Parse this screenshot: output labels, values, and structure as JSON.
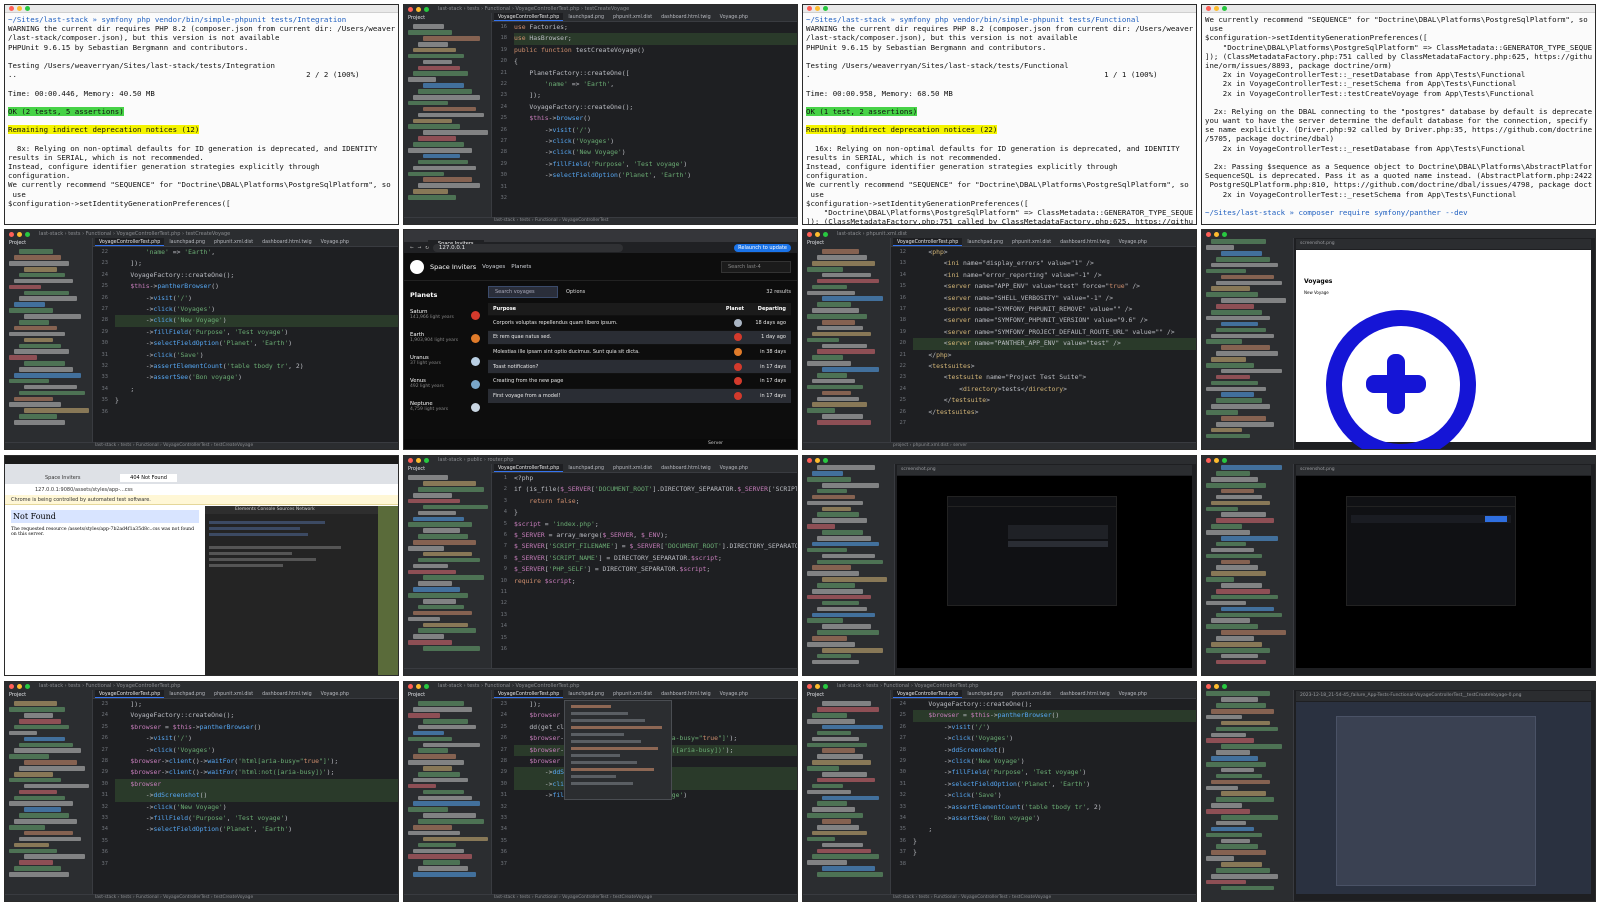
{
  "term1": {
    "lines": [
      "~/Sites/last-stack » symfony php vendor/bin/simple-phpunit tests/Integration",
      "WARNING the current dir requires PHP 8.2 (composer.json from current dir: /Users/weaverryan/Sites",
      "/last-stack/composer.json), but this version is not available",
      "PHPUnit 9.6.15 by Sebastian Bergmann and contributors.",
      "",
      "Testing /Users/weaverryan/Sites/last-stack/tests/Integration",
      "..                                                                 2 / 2 (100%)",
      "",
      "Time: 00:00.446, Memory: 40.50 MB",
      "",
      "OK (2 tests, 5 assertions)",
      "",
      "Remaining indirect deprecation notices (12)",
      "",
      "  8x: Relying on non-optimal defaults for ID generation is deprecated, and IDENTITY",
      "results in SERIAL, which is not recommended.",
      "Instead, configure identifier generation strategies explicitly through",
      "configuration.",
      "We currently recommend \"SEQUENCE\" for \"Doctrine\\DBAL\\Platforms\\PostgreSqlPlatform\", so you should",
      " use",
      "$configuration->setIdentityGenerationPreferences(["
    ]
  },
  "term2": {
    "lines": [
      "~/Sites/last-stack » symfony php vendor/bin/simple-phpunit tests/Functional",
      "WARNING the current dir requires PHP 8.2 (composer.json from current dir: /Users/weaverryan/Sites",
      "/last-stack/composer.json), but this version is not available",
      "PHPUnit 9.6.15 by Sebastian Bergmann and contributors.",
      "",
      "Testing /Users/weaverryan/Sites/last-stack/tests/Functional",
      ".                                                                  1 / 1 (100%)",
      "",
      "Time: 00:00.958, Memory: 68.50 MB",
      "",
      "OK (1 test, 2 assertions)",
      "",
      "Remaining indirect deprecation notices (22)",
      "",
      "  16x: Relying on non-optimal defaults for ID generation is deprecated, and IDENTITY",
      "results in SERIAL, which is not recommended.",
      "Instead, configure identifier generation strategies explicitly through",
      "configuration.",
      "We currently recommend \"SEQUENCE\" for \"Doctrine\\DBAL\\Platforms\\PostgreSqlPlatform\", so you should",
      " use",
      "$configuration->setIdentityGenerationPreferences([",
      "    \"Doctrine\\DBAL\\Platforms\\PostgreSqlPlatform\" => ClassMetadata::GENERATOR_TYPE_SEQUENCE,",
      "]); (ClassMetadataFactory.php:751 called by ClassMetadataFactory.php:625, https://github.com/doct"
    ]
  },
  "term3": {
    "lines": [
      "We currently recommend \"SEQUENCE\" for \"Doctrine\\DBAL\\Platforms\\PostgreSqlPlatform\", so you should",
      " use",
      "$configuration->setIdentityGenerationPreferences([",
      "    \"Doctrine\\DBAL\\Platforms\\PostgreSqlPlatform\" => ClassMetadata::GENERATOR_TYPE_SEQUENCE,",
      "]); (ClassMetadataFactory.php:751 called by ClassMetadataFactory.php:625, https://github.com/doctr",
      "ine/orm/issues/8893, package doctrine/orm)",
      "    2x in VoyageControllerTest::_resetDatabase from App\\Tests\\Functional",
      "    2x in VoyageControllerTest::_resetSchema from App\\Tests\\Functional",
      "    2x in VoyageControllerTest::testCreateVoyage from App\\Tests\\Functional",
      "",
      "  2x: Relying on the DBAL connecting to the \"postgres\" database by default is deprecated. Unless",
      "you want to have the server determine the default database for the connection, specify the databa",
      "se name explicitly. (Driver.php:92 called by Driver.php:35, https://github.com/doctrine/dbal/pull",
      "/5705, package doctrine/dbal)",
      "    2x in VoyageControllerTest::_resetDatabase from App\\Tests\\Functional",
      "",
      "  2x: Passing $sequence as a Sequence object to Doctrine\\DBAL\\Platforms\\AbstractPlatform::getDrop",
      "SequenceSQL is deprecated. Pass it as a quoted name instead. (AbstractPlatform.php:2422 called by",
      " PostgreSQLPlatform.php:810, https://github.com/doctrine/dbal/issues/4798, package doctrine/dbal)",
      "    2x in VoyageControllerTest::_resetSchema from App\\Tests\\Functional",
      "",
      "~/Sites/last-stack » composer require symfony/panther --dev"
    ]
  },
  "ide_common": {
    "project_label": "Project",
    "tabs": [
      "VoyageControllerTest.php",
      "launchpad.png",
      "phpunit.xml.dist",
      "dashboard.html.twig",
      "Voyage.php"
    ]
  },
  "ide1": {
    "crumb": "last-stack › tests › Functional › VoyageControllerTest.php › testCreateVoyage",
    "lines": [
      [
        "16",
        "use Factories;"
      ],
      [
        "18",
        "use HasBrowser;"
      ],
      [
        "19",
        ""
      ],
      [
        "20",
        "public function testCreateVoyage()"
      ],
      [
        "21",
        "{"
      ],
      [
        "22",
        "    PlanetFactory::createOne(["
      ],
      [
        "23",
        "        'name' => 'Earth',"
      ],
      [
        "24",
        "    ]);"
      ],
      [
        "25",
        "    VoyageFactory::createOne();"
      ],
      [
        "26",
        ""
      ],
      [
        "27",
        "    $this->browser()"
      ],
      [
        "28",
        "        ->visit('/')"
      ],
      [
        "29",
        "        ->click('Voyages')"
      ],
      [
        "30",
        "        ->click('New Voyage')"
      ],
      [
        "31",
        "        ->fillField('Purpose', 'Test voyage')"
      ],
      [
        "32",
        "        ->selectFieldOption('Planet', 'Earth')"
      ]
    ],
    "status": "last-stack › tests › Functional › VoyageControllerTest"
  },
  "ide2": {
    "crumb": "last-stack › tests › Functional › VoyageControllerTest.php › testCreateVoyage",
    "lines": [
      [
        "22",
        "        'name' => 'Earth',"
      ],
      [
        "23",
        "    ]);"
      ],
      [
        "24",
        "    VoyageFactory::createOne();"
      ],
      [
        "25",
        ""
      ],
      [
        "26",
        "    $this->pantherBrowser()"
      ],
      [
        "27",
        "        ->visit('/')"
      ],
      [
        "28",
        "        ->click('Voyages')"
      ],
      [
        "29",
        "        ->click('New Voyage')"
      ],
      [
        "30",
        "        ->fillField('Purpose', 'Test voyage')"
      ],
      [
        "31",
        "        ->selectFieldOption('Planet', 'Earth')"
      ],
      [
        "32",
        "        ->click('Save')"
      ],
      [
        "33",
        "        ->assertElementCount('table tbody tr', 2)"
      ],
      [
        "34",
        "        ->assertSee('Bon voyage')"
      ],
      [
        "35",
        "    ;"
      ],
      [
        "36",
        "}"
      ]
    ],
    "status": "last-stack › tests › Functional › VoyageControllerTest › testCreateVoyage"
  },
  "ide3": {
    "crumb": "last-stack › phpunit.xml.dist",
    "lines": [
      [
        "12",
        "    <php>"
      ],
      [
        "13",
        "        <ini name=\"display_errors\" value=\"1\" />"
      ],
      [
        "14",
        "        <ini name=\"error_reporting\" value=\"-1\" />"
      ],
      [
        "15",
        "        <server name=\"APP_ENV\" value=\"test\" force=\"true\" />"
      ],
      [
        "16",
        "        <server name=\"SHELL_VERBOSITY\" value=\"-1\" />"
      ],
      [
        "17",
        "        <server name=\"SYMFONY_PHPUNIT_REMOVE\" value=\"\" />"
      ],
      [
        "18",
        "        <server name=\"SYMFONY_PHPUNIT_VERSION\" value=\"9.6\" />"
      ],
      [
        "19",
        "        <server name=\"SYMFONY_PROJECT_DEFAULT_ROUTE_URL\" value=\"\" />"
      ],
      [
        "20",
        "        <server name=\"PANTHER_APP_ENV\" value=\"test\" />"
      ],
      [
        "21",
        "    </php>"
      ],
      [
        "22",
        ""
      ],
      [
        "23",
        "    <testsuites>"
      ],
      [
        "24",
        "        <testsuite name=\"Project Test Suite\">"
      ],
      [
        "25",
        "            <directory>tests</directory>"
      ],
      [
        "26",
        "        </testsuite>"
      ],
      [
        "27",
        "    </testsuites>"
      ]
    ],
    "status": "project › phpunit.xml.dist › server"
  },
  "ide4": {
    "crumb": "last-stack › public › router.php",
    "lines": [
      [
        "1",
        "<?php"
      ],
      [
        "2",
        "if (is_file($_SERVER['DOCUMENT_ROOT'].DIRECTORY_SEPARATOR.$_SERVER['SCRIPT_NAME"
      ],
      [
        "3",
        "    return false;"
      ],
      [
        "4",
        "}"
      ],
      [
        "5",
        ""
      ],
      [
        "6",
        "$script = 'index.php';"
      ],
      [
        "7",
        ""
      ],
      [
        "8",
        "$_SERVER = array_merge($_SERVER, $_ENV);"
      ],
      [
        "9",
        "$_SERVER['SCRIPT_FILENAME'] = $_SERVER['DOCUMENT_ROOT'].DIRECTORY_SEPARATOR.$sc"
      ],
      [
        "10",
        ""
      ],
      [
        "11",
        "$_SERVER['SCRIPT_NAME'] = DIRECTORY_SEPARATOR.$script;"
      ],
      [
        "12",
        "$_SERVER['PHP_SELF'] = DIRECTORY_SEPARATOR.$script;"
      ],
      [
        "13",
        ""
      ],
      [
        "14",
        "require $script;"
      ],
      [
        "15",
        ""
      ],
      [
        "16",
        ""
      ]
    ],
    "status": ""
  },
  "ide5": {
    "crumb": "last-stack › tests › Functional › VoyageControllerTest.php",
    "lines": [
      [
        "23",
        "    ]);"
      ],
      [
        "24",
        "    VoyageFactory::createOne();"
      ],
      [
        "25",
        ""
      ],
      [
        "26",
        "    $browser = $this->pantherBrowser()"
      ],
      [
        "27",
        "        ->visit('/')"
      ],
      [
        "28",
        "        ->click('Voyages')"
      ],
      [
        "29",
        ""
      ],
      [
        "30",
        "    $browser->client()->waitFor('html[aria-busy=\"true\"]');"
      ],
      [
        "31",
        "    $browser->client()->waitFor('html:not([aria-busy])');"
      ],
      [
        "32",
        ""
      ],
      [
        "33",
        "    $browser"
      ],
      [
        "34",
        "        ->ddScreenshot()"
      ],
      [
        "35",
        "        ->click('New Voyage')"
      ],
      [
        "36",
        "        ->fillField('Purpose', 'Test voyage')"
      ],
      [
        "37",
        "        ->selectFieldOption('Planet', 'Earth')"
      ]
    ],
    "status": "last-stack › tests › Functional › VoyageControllerTest › testCreateVoyage"
  },
  "ide6": {
    "crumb": "last-stack › tests › Functional › VoyageControllerTest.php",
    "lines": [
      [
        "23",
        "    ]);"
      ],
      [
        "24",
        ""
      ],
      [
        "25",
        "    $browser"
      ],
      [
        "26",
        ""
      ],
      [
        "27",
        ""
      ],
      [
        "28",
        ""
      ],
      [
        "29",
        "    dd(get_class($browser));"
      ],
      [
        "30",
        ""
      ],
      [
        "31",
        "    $browser->client()->waitFor('html[aria-busy=\"true\"]');"
      ],
      [
        "32",
        "    $browser->client()->waitFor('html:not([aria-busy])');"
      ],
      [
        "33",
        ""
      ],
      [
        "34",
        "    $browser"
      ],
      [
        "35",
        "        ->ddScreenshot()"
      ],
      [
        "36",
        "        ->click('New Voyage')"
      ],
      [
        "37",
        "        ->fillField('Purpose', 'Test voyage')"
      ]
    ],
    "status": "last-stack › tests › Functional › VoyageControllerTest › testCreateVoyage"
  },
  "ide7": {
    "crumb": "last-stack › tests › Functional › VoyageControllerTest.php",
    "lines": [
      [
        "24",
        "    VoyageFactory::createOne();"
      ],
      [
        "25",
        ""
      ],
      [
        "26",
        "    $browser = $this->pantherBrowser()"
      ],
      [
        "27",
        "        ->visit('/')"
      ],
      [
        "28",
        "        ->click('Voyages')"
      ],
      [
        "29",
        "        ->ddScreenshot()"
      ],
      [
        "30",
        "        ->click('New Voyage')"
      ],
      [
        "31",
        "        ->fillField('Purpose', 'Test voyage')"
      ],
      [
        "32",
        "        ->selectFieldOption('Planet', 'Earth')"
      ],
      [
        "33",
        "        ->click('Save')"
      ],
      [
        "34",
        "        ->assertElementCount('table tbody tr', 2)"
      ],
      [
        "35",
        "        ->assertSee('Bon voyage')"
      ],
      [
        "36",
        "    ;"
      ],
      [
        "37",
        "}"
      ],
      [
        "38",
        "}"
      ]
    ],
    "status": "last-stack › tests › Functional › VoyageControllerTest › testCreateVoyage"
  },
  "voyages_app": {
    "tab": "Space Inviters",
    "url": "127.0.0.1",
    "relaunch": "Relaunch to update",
    "app_title": "Space Inviters",
    "nav": [
      "Voyages",
      "Planets"
    ],
    "search_placeholder": "Search last-4",
    "planets_heading": "Planets",
    "planets": [
      {
        "name": "Saturn",
        "dist": "141,966 light years",
        "color": "#d33a2c"
      },
      {
        "name": "Earth",
        "dist": "1,903,904 light years",
        "color": "#e07b2a"
      },
      {
        "name": "Uranus",
        "dist": "37 light years",
        "color": "#b9cfe3"
      },
      {
        "name": "Venus",
        "dist": "492 light years",
        "color": "#7aa6c8"
      },
      {
        "name": "Neptune",
        "dist": "4,759 light years",
        "color": "#c9d6e2"
      }
    ],
    "voyage_search_placeholder": "Search voyages",
    "options_label": "Options",
    "results_count": "32 results",
    "columns": {
      "purpose": "Purpose",
      "planet": "Planet",
      "departing": "Departing"
    },
    "rows": [
      {
        "purpose": "Corporis voluptas repellendus quam libero ipsum.",
        "color": "#aab5c4",
        "when": "18 days ago"
      },
      {
        "purpose": "Et rem quae natus sed.",
        "color": "#d33a2c",
        "when": "1 day ago"
      },
      {
        "purpose": "Molestias ille ipsam sint optio ducimus. Sunt quia sit dicta.",
        "color": "#e07b2a",
        "when": "in 38 days"
      },
      {
        "purpose": "Toast notification?",
        "color": "#d33a2c",
        "when": "in 17 days"
      },
      {
        "purpose": "Creating from the new page",
        "color": "#d33a2c",
        "when": "in 17 days"
      },
      {
        "purpose": "First voyage from a model!",
        "color": "#d33a2c",
        "when": "in 17 days"
      }
    ],
    "status": "Server"
  },
  "screenshot1": {
    "header": "screenshot.png",
    "heading": "Voyages",
    "sub": "New Voyage"
  },
  "notfound": {
    "tab1": "Space Inviters",
    "tab2": "404 Not Found",
    "url": "127.0.0.1:9080/assets/styles/app-...css",
    "controlled": "Chrome is being controlled by automated test software.",
    "heading": "Not Found",
    "message": "The requested resource /assets/styles/app-7b2ad4f1a35d8c..css was not found on this server.",
    "devtools": "Elements  Console  Sources  Network"
  },
  "screenshot2": {
    "header": "screenshot.png"
  },
  "screenshot3": {
    "header": "screenshot.png"
  },
  "screenshot4": {
    "header": "2023-12-18_21-54-45_failure_App-Tests-Functional-VoyageControllerTest__testCreateVoyage-0.png"
  }
}
